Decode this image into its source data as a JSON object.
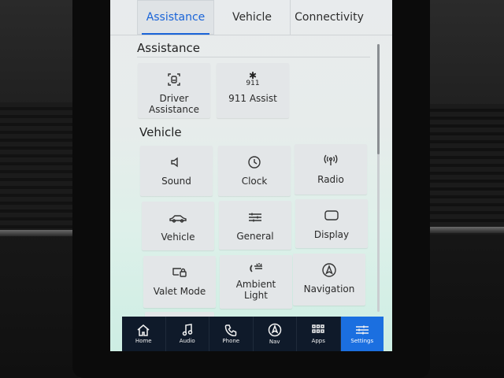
{
  "tabs": [
    "Assistance",
    "Vehicle",
    "Connectivity"
  ],
  "sections": {
    "assistance": {
      "title": "Assistance",
      "tiles": [
        {
          "label_line1": "Driver",
          "label_line2": "Assistance",
          "icon": "driver-assistance-icon"
        },
        {
          "label_line1": "911 Assist",
          "icon": "911-assist-icon",
          "icon_text": "911"
        }
      ]
    },
    "vehicle": {
      "title": "Vehicle",
      "tiles": [
        {
          "label_line1": "Sound",
          "icon": "speaker-icon"
        },
        {
          "label_line1": "Clock",
          "icon": "clock-icon"
        },
        {
          "label_line1": "Radio",
          "icon": "radio-antenna-icon"
        },
        {
          "label_line1": "Vehicle",
          "icon": "car-icon"
        },
        {
          "label_line1": "General",
          "icon": "sliders-icon"
        },
        {
          "label_line1": "Display",
          "icon": "display-icon"
        },
        {
          "label_line1": "Valet Mode",
          "icon": "valet-lock-icon"
        },
        {
          "label_line1": "Ambient",
          "label_line2": "Light",
          "icon": "ambient-light-icon"
        },
        {
          "label_line1": "Navigation",
          "icon": "navigation-icon"
        }
      ]
    }
  },
  "navbar": {
    "items": [
      {
        "label": "Home",
        "icon": "home-icon"
      },
      {
        "label": "Audio",
        "icon": "music-note-icon"
      },
      {
        "label": "Phone",
        "icon": "phone-icon"
      },
      {
        "label": "Nav",
        "icon": "nav-compass-icon"
      },
      {
        "label": "Apps",
        "icon": "apps-grid-icon"
      },
      {
        "label": "Settings",
        "icon": "settings-sliders-icon"
      }
    ],
    "active": "Settings"
  },
  "colors": {
    "accent": "#1a64d8",
    "navbar_bg": "#0f1a2a",
    "navbar_active": "#1b6fe0"
  }
}
